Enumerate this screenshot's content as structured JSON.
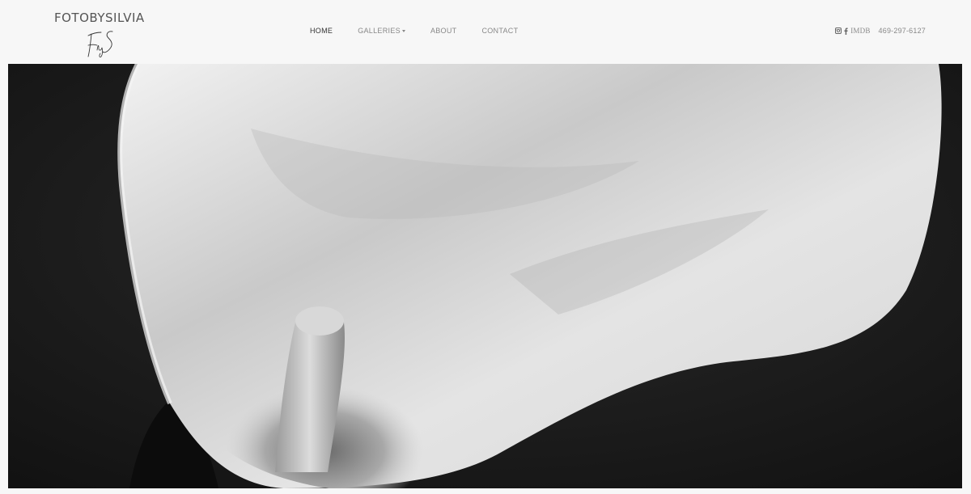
{
  "brand": {
    "name": "FOTOBYSILVIA",
    "signature_text": "FbyS",
    "signature_icon": "signature-logo"
  },
  "nav": {
    "items": [
      {
        "label": "HOME",
        "active": true
      },
      {
        "label": "GALLERIES",
        "active": false,
        "has_dropdown": true
      },
      {
        "label": "ABOUT",
        "active": false
      },
      {
        "label": "CONTACT",
        "active": false
      }
    ]
  },
  "social": {
    "instagram_icon": "instagram-icon",
    "facebook_icon": "facebook-icon",
    "imdb_label": "IMDB",
    "phone": "469-297-6127"
  },
  "hero": {
    "image_subject": "calla-lily-photo",
    "colors": {
      "background": "#1a1a1a",
      "petal_light": "#e8e8e8",
      "petal_shadow": "#9a9a9a"
    }
  }
}
